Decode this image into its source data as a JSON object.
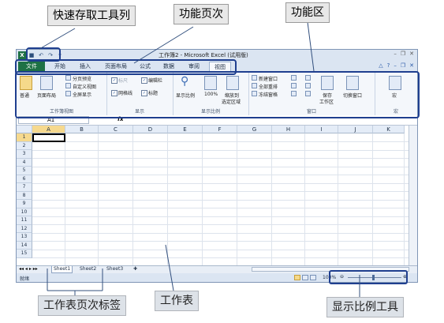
{
  "callouts": {
    "qat": "快速存取工具列",
    "tab_pages": "功能页次",
    "ribbon": "功能区",
    "sheet_tabs": "工作表页次标签",
    "worksheet": "工作表",
    "zoom_tool": "显示比例工具"
  },
  "window": {
    "title": "工作簿2 - Microsoft Excel (试用版)",
    "app_icon": "excel-icon"
  },
  "tabs": [
    "文件",
    "开始",
    "插入",
    "页面布局",
    "公式",
    "数据",
    "审阅",
    "视图"
  ],
  "active_tab": "视图",
  "ribbon": {
    "workbook_views": {
      "normal": "普通",
      "page_layout": "页面布局",
      "page_break": "分页预览",
      "custom_views": "自定义视图",
      "full_screen": "全屏显示",
      "group": "工作簿视图"
    },
    "show": {
      "ruler": "标尺",
      "formula_bar": "编辑栏",
      "gridlines": "网格线",
      "headings": "标题",
      "group": "显示"
    },
    "zoom": {
      "zoom": "显示比例",
      "pct100": "100%",
      "zoom_sel_1": "缩放到",
      "zoom_sel_2": "选定区域",
      "group": "显示比例"
    },
    "window": {
      "new_window": "新建窗口",
      "arrange_all": "全部重排",
      "freeze_panes": "冻结窗格",
      "save_ws_1": "保存",
      "save_ws_2": "工作区",
      "switch_windows": "切换窗口",
      "group": "窗口"
    },
    "macros": {
      "macros": "宏",
      "group": "宏"
    }
  },
  "formula_bar": {
    "cell_ref": "A1",
    "fx": "fx"
  },
  "columns": [
    "A",
    "B",
    "C",
    "D",
    "E",
    "F",
    "G",
    "H",
    "I",
    "J",
    "K"
  ],
  "rows": [
    "1",
    "2",
    "3",
    "4",
    "5",
    "6",
    "7",
    "8",
    "9",
    "10",
    "11",
    "12",
    "13",
    "14",
    "15"
  ],
  "sheets": [
    "Sheet1",
    "Sheet2",
    "Sheet3"
  ],
  "status": {
    "ready": "就绪",
    "zoom": "100%"
  },
  "colors": {
    "file_tab": "#1e7145",
    "callout_bg": "#e8e8e8",
    "highlight": "#1f3f8f"
  }
}
